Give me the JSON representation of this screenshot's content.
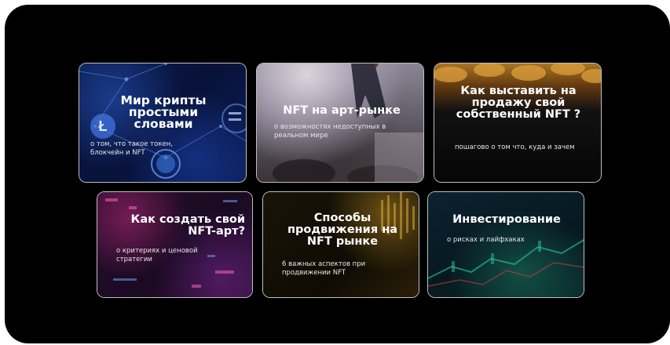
{
  "cards": [
    {
      "title": "Мир крипты простыми словами",
      "desc": "о том, что такое токен, блокчейн и NFT",
      "icon": "crypto-network-icon"
    },
    {
      "title": "NFT на арт-рынке",
      "desc": "о возможностях недоступных в реальном мире",
      "icon": "auction-icon"
    },
    {
      "title": "Как выставить на продажу свой собственный NFT ?",
      "desc": "пошагово о том что, куда и зачем",
      "icon": "coins-icon"
    },
    {
      "title": "Как создать свой NFT-арт?",
      "desc": "о критериях и ценовой стратегии",
      "icon": "pixel-art-icon"
    },
    {
      "title": "Способы продвижения на NFT рынке",
      "desc": "6 важных аспектов при продвижении NFT",
      "icon": "data-chart-icon"
    },
    {
      "title": "Инвестирование",
      "desc": "о рисках и лайфхаках",
      "icon": "candlestick-chart-icon"
    }
  ],
  "colors": {
    "frame": "#000000",
    "card_border": "#ffffff",
    "text": "#ffffff"
  }
}
